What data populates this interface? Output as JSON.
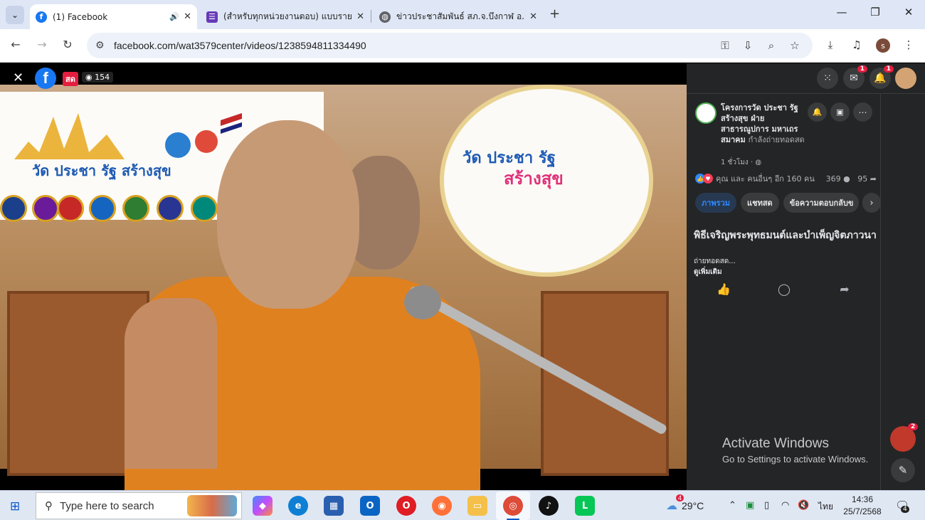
{
  "browser": {
    "tabs": [
      {
        "title": "(1) Facebook",
        "favicon": "facebook-icon",
        "active": true
      },
      {
        "title": "(สำหรับทุกหน่วยงานตอบ) แบบรายงา",
        "favicon": "forms-icon",
        "active": false
      },
      {
        "title": "ข่าวประชาสัมพันธ์ สภ.จ.บึงกาฬ อ.เมื",
        "favicon": "globe-icon",
        "active": false
      }
    ],
    "url": "facebook.com/wat3579center/videos/1238594811334490",
    "profile_initial": "s"
  },
  "video": {
    "live_label": "สด",
    "view_count": "154",
    "banner_text": "วัด ประชา รัฐ สร้างสุข",
    "fan_line1": "วัด ประชา รัฐ",
    "fan_line2": "สร้างสุข"
  },
  "facebook_header": {
    "messenger_badge": "1",
    "notifications_badge": "1"
  },
  "post": {
    "page_name": "โครงการวัด ประชา รัฐ สร้างสุข ฝ่ายสาธารณูปการ มหาเถรสมาคม",
    "live_status": "กำลังถ่ายทอดสด",
    "time": "1 ชั่วโมง",
    "reactions_text": "คุณ และ คนอื่นๆ อีก 160 คน",
    "comment_count": "369",
    "share_count": "95",
    "tabs": [
      "ภาพรวม",
      "แชทสด",
      "ข้อความตอบกลับข"
    ],
    "title": "พิธีเจริญพระพุทธมนต์และบำเพ็ญจิตภาวนา",
    "description": "ถ่ายทอดสด...",
    "see_more": "ดูเพิ่มเติม"
  },
  "chat": {
    "badge": "2"
  },
  "watermark": {
    "line1": "Activate Windows",
    "line2": "Go to Settings to activate Windows."
  },
  "taskbar": {
    "search_placeholder": "Type here to search",
    "weather_badge": "4",
    "temperature": "29°C",
    "language": "ไทย",
    "time": "14:36",
    "date": "25/7/2568",
    "notification_count": "4"
  },
  "colors": {
    "facebook_blue": "#1877f2",
    "panel_bg": "#242526",
    "live_red": "#e41e3f",
    "robe_orange": "#e0811f"
  }
}
